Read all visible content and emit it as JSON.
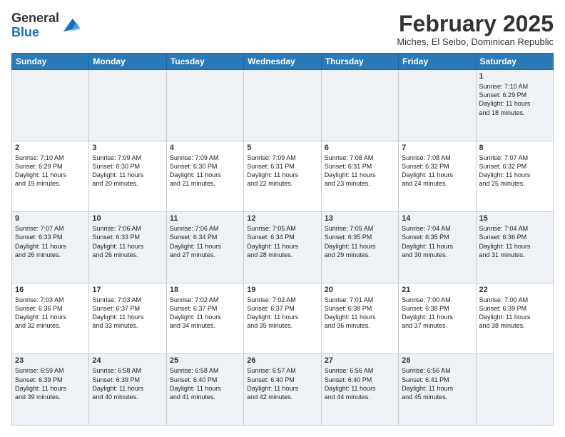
{
  "header": {
    "logo_line1": "General",
    "logo_line2": "Blue",
    "month_title": "February 2025",
    "location": "Miches, El Seibo, Dominican Republic"
  },
  "weekdays": [
    "Sunday",
    "Monday",
    "Tuesday",
    "Wednesday",
    "Thursday",
    "Friday",
    "Saturday"
  ],
  "weeks": [
    [
      {
        "day": "",
        "info": ""
      },
      {
        "day": "",
        "info": ""
      },
      {
        "day": "",
        "info": ""
      },
      {
        "day": "",
        "info": ""
      },
      {
        "day": "",
        "info": ""
      },
      {
        "day": "",
        "info": ""
      },
      {
        "day": "1",
        "info": "Sunrise: 7:10 AM\nSunset: 6:29 PM\nDaylight: 11 hours\nand 18 minutes."
      }
    ],
    [
      {
        "day": "2",
        "info": "Sunrise: 7:10 AM\nSunset: 6:29 PM\nDaylight: 11 hours\nand 19 minutes."
      },
      {
        "day": "3",
        "info": "Sunrise: 7:09 AM\nSunset: 6:30 PM\nDaylight: 11 hours\nand 20 minutes."
      },
      {
        "day": "4",
        "info": "Sunrise: 7:09 AM\nSunset: 6:30 PM\nDaylight: 11 hours\nand 21 minutes."
      },
      {
        "day": "5",
        "info": "Sunrise: 7:09 AM\nSunset: 6:31 PM\nDaylight: 11 hours\nand 22 minutes."
      },
      {
        "day": "6",
        "info": "Sunrise: 7:08 AM\nSunset: 6:31 PM\nDaylight: 11 hours\nand 23 minutes."
      },
      {
        "day": "7",
        "info": "Sunrise: 7:08 AM\nSunset: 6:32 PM\nDaylight: 11 hours\nand 24 minutes."
      },
      {
        "day": "8",
        "info": "Sunrise: 7:07 AM\nSunset: 6:32 PM\nDaylight: 11 hours\nand 25 minutes."
      }
    ],
    [
      {
        "day": "9",
        "info": "Sunrise: 7:07 AM\nSunset: 6:33 PM\nDaylight: 11 hours\nand 26 minutes."
      },
      {
        "day": "10",
        "info": "Sunrise: 7:06 AM\nSunset: 6:33 PM\nDaylight: 11 hours\nand 26 minutes."
      },
      {
        "day": "11",
        "info": "Sunrise: 7:06 AM\nSunset: 6:34 PM\nDaylight: 11 hours\nand 27 minutes."
      },
      {
        "day": "12",
        "info": "Sunrise: 7:05 AM\nSunset: 6:34 PM\nDaylight: 11 hours\nand 28 minutes."
      },
      {
        "day": "13",
        "info": "Sunrise: 7:05 AM\nSunset: 6:35 PM\nDaylight: 11 hours\nand 29 minutes."
      },
      {
        "day": "14",
        "info": "Sunrise: 7:04 AM\nSunset: 6:35 PM\nDaylight: 11 hours\nand 30 minutes."
      },
      {
        "day": "15",
        "info": "Sunrise: 7:04 AM\nSunset: 6:36 PM\nDaylight: 11 hours\nand 31 minutes."
      }
    ],
    [
      {
        "day": "16",
        "info": "Sunrise: 7:03 AM\nSunset: 6:36 PM\nDaylight: 11 hours\nand 32 minutes."
      },
      {
        "day": "17",
        "info": "Sunrise: 7:03 AM\nSunset: 6:37 PM\nDaylight: 11 hours\nand 33 minutes."
      },
      {
        "day": "18",
        "info": "Sunrise: 7:02 AM\nSunset: 6:37 PM\nDaylight: 11 hours\nand 34 minutes."
      },
      {
        "day": "19",
        "info": "Sunrise: 7:02 AM\nSunset: 6:37 PM\nDaylight: 11 hours\nand 35 minutes."
      },
      {
        "day": "20",
        "info": "Sunrise: 7:01 AM\nSunset: 6:38 PM\nDaylight: 11 hours\nand 36 minutes."
      },
      {
        "day": "21",
        "info": "Sunrise: 7:00 AM\nSunset: 6:38 PM\nDaylight: 11 hours\nand 37 minutes."
      },
      {
        "day": "22",
        "info": "Sunrise: 7:00 AM\nSunset: 6:39 PM\nDaylight: 11 hours\nand 38 minutes."
      }
    ],
    [
      {
        "day": "23",
        "info": "Sunrise: 6:59 AM\nSunset: 6:39 PM\nDaylight: 11 hours\nand 39 minutes."
      },
      {
        "day": "24",
        "info": "Sunrise: 6:58 AM\nSunset: 6:39 PM\nDaylight: 11 hours\nand 40 minutes."
      },
      {
        "day": "25",
        "info": "Sunrise: 6:58 AM\nSunset: 6:40 PM\nDaylight: 11 hours\nand 41 minutes."
      },
      {
        "day": "26",
        "info": "Sunrise: 6:57 AM\nSunset: 6:40 PM\nDaylight: 11 hours\nand 42 minutes."
      },
      {
        "day": "27",
        "info": "Sunrise: 6:56 AM\nSunset: 6:40 PM\nDaylight: 11 hours\nand 44 minutes."
      },
      {
        "day": "28",
        "info": "Sunrise: 6:56 AM\nSunset: 6:41 PM\nDaylight: 11 hours\nand 45 minutes."
      },
      {
        "day": "",
        "info": ""
      }
    ]
  ]
}
